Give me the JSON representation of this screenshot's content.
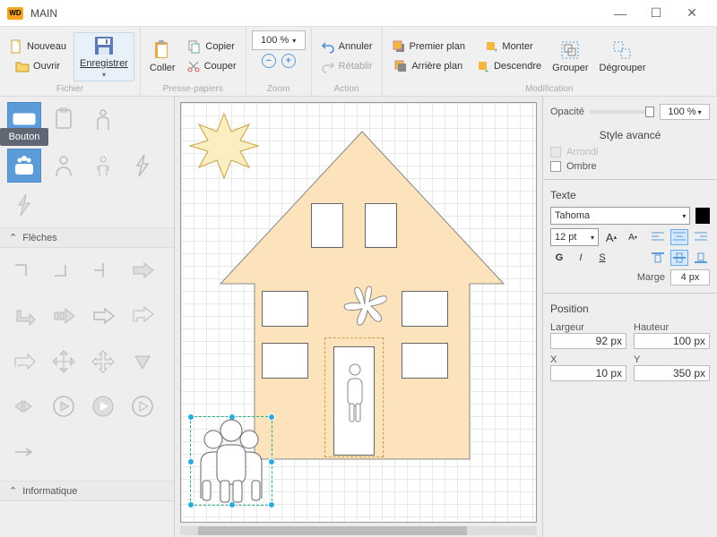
{
  "window": {
    "app_logo_text": "WD",
    "title": "MAIN"
  },
  "ribbon": {
    "file": {
      "new": "Nouveau",
      "open": "Ouvrir",
      "save": "Enregistrer",
      "label": "Fichier"
    },
    "clipboard": {
      "paste": "Coller",
      "copy": "Copier",
      "cut": "Couper",
      "label": "Presse-papiers"
    },
    "zoom": {
      "value": "100 %",
      "label": "Zoom"
    },
    "action": {
      "undo": "Annuler",
      "redo": "Rétablir",
      "label": "Action"
    },
    "modify": {
      "foreground": "Premier plan",
      "background": "Arrière plan",
      "up": "Monter",
      "down": "Descendre",
      "group": "Grouper",
      "ungroup": "Dégrouper",
      "label": "Modification"
    }
  },
  "left_panel": {
    "tooltip_button": "Bouton",
    "section_arrows": "Flèches",
    "section_it": "Informatique"
  },
  "right_panel": {
    "opacity_label": "Opacité",
    "opacity_value": "100 %",
    "style_section": "Style avancé",
    "rounded": "Arrondi",
    "shadow": "Ombre",
    "text_section": "Texte",
    "font": "Tahoma",
    "font_size": "12 pt",
    "bold": "G",
    "italic": "I",
    "underline": "S",
    "margin_label": "Marge",
    "margin_value": "4 px",
    "position_section": "Position",
    "width_label": "Largeur",
    "width_value": "92 px",
    "height_label": "Hauteur",
    "height_value": "100 px",
    "x_label": "X",
    "x_value": "10 px",
    "y_label": "Y",
    "y_value": "350 px"
  }
}
